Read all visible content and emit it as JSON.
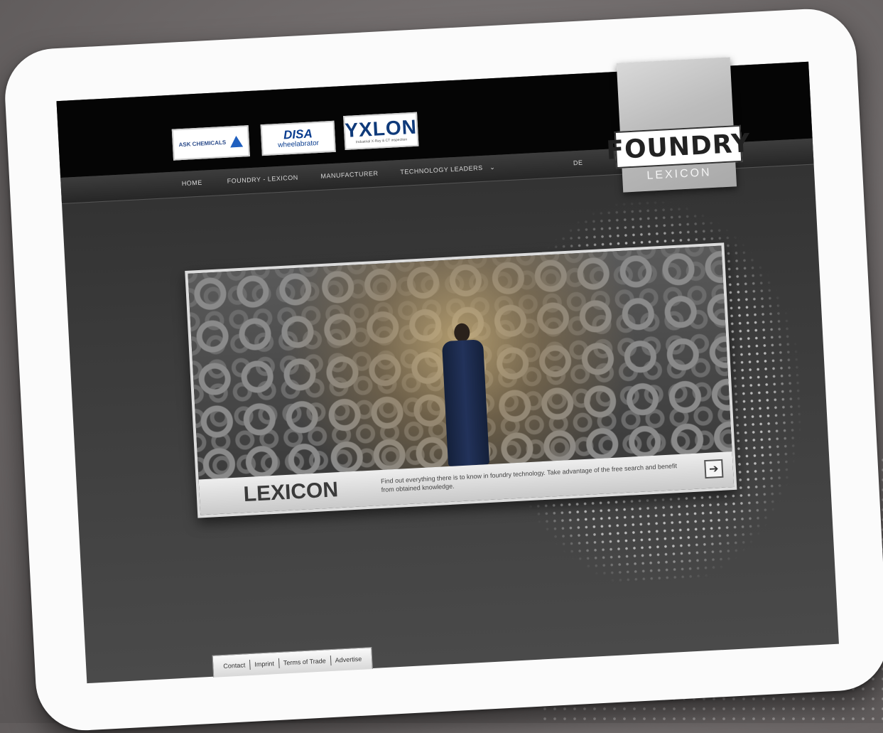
{
  "logos": {
    "ask": "ASK CHEMICALS",
    "disa_big": "DISA",
    "disa_small": "wheelabrator",
    "yxlon_big": "YXLON",
    "yxlon_small": "Industrial X-Ray & CT inspection"
  },
  "nav": {
    "items": [
      "HOME",
      "FOUNDRY - LEXICON",
      "MANUFACTURER",
      "TECHNOLOGY LEADERS"
    ],
    "lang": "DE",
    "dropdown_icon": "chevron-down-icon"
  },
  "brand": {
    "title": "FOUNDRY",
    "subtitle": "LEXICON"
  },
  "hero": {
    "title": "LEXICON",
    "description": "Find out everything there is to know in foundry technology. Take advantage of the free search and benefit from obtained knowledge.",
    "arrow_icon": "arrow-right-icon"
  },
  "footer": {
    "links": [
      "Contact",
      "Imprint",
      "Terms of Trade",
      "Advertise"
    ]
  }
}
